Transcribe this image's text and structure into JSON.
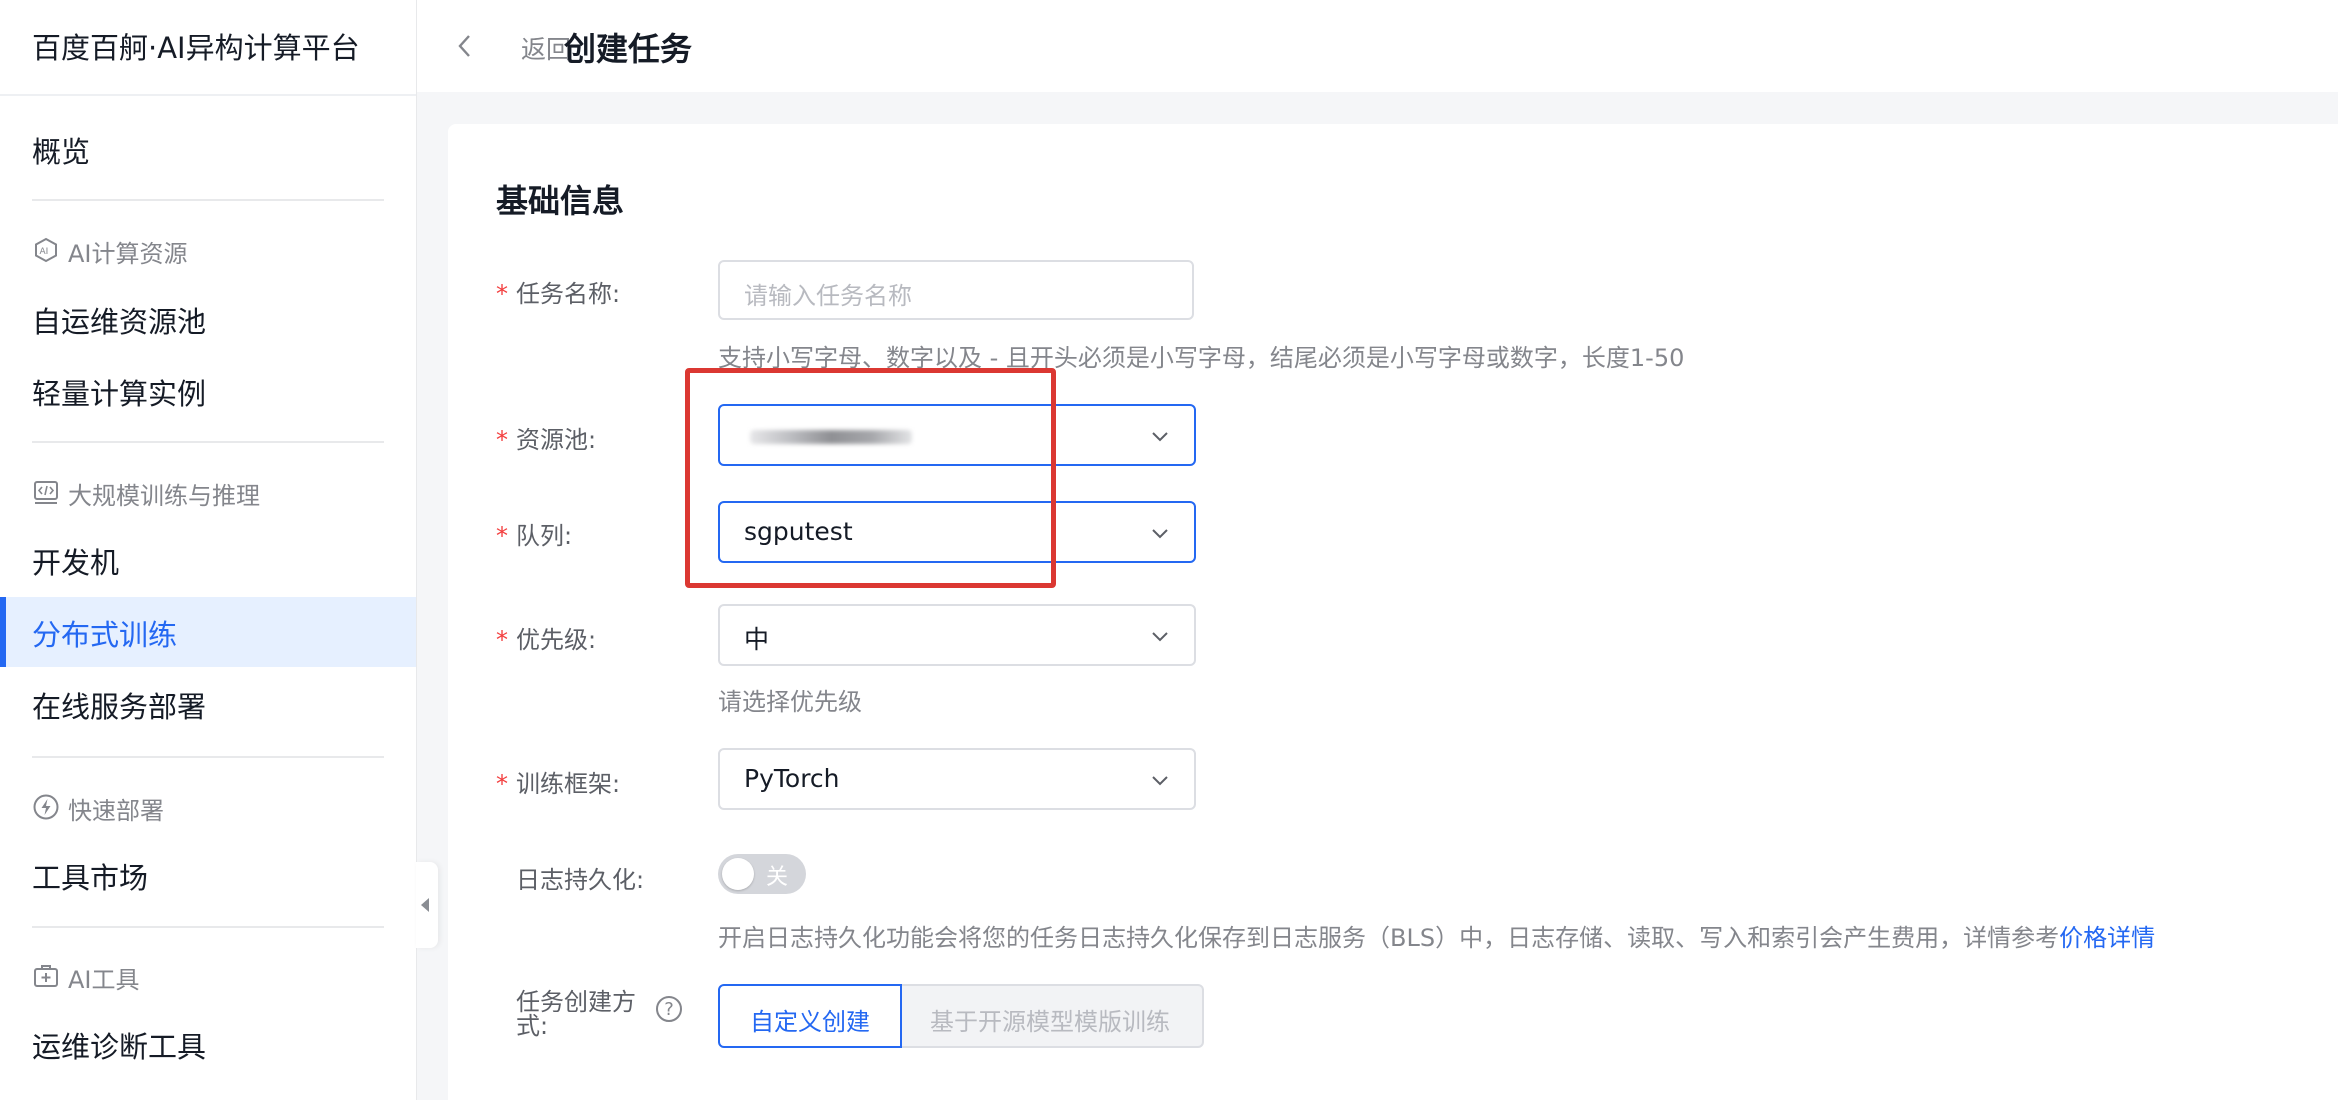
{
  "app": {
    "brand": "百度百舸·AI异构计算平台"
  },
  "sidebar": {
    "overview": "概览",
    "groups": [
      {
        "label": "AI计算资源",
        "icon": "ai-chip-icon"
      },
      {
        "label": "大规模训练与推理",
        "icon": "code-window-icon"
      },
      {
        "label": "快速部署",
        "icon": "lightning-icon"
      },
      {
        "label": "AI工具",
        "icon": "toolbox-icon"
      }
    ],
    "items": {
      "self_ops_pool": "自运维资源池",
      "light_compute": "轻量计算实例",
      "dev_machine": "开发机",
      "distributed_training": "分布式训练",
      "online_service": "在线服务部署",
      "tool_market": "工具市场",
      "ops_diagnosis": "运维诊断工具"
    }
  },
  "header": {
    "back": "返回",
    "title": "创建任务"
  },
  "form": {
    "section_title": "基础信息",
    "task_name": {
      "label": "任务名称:",
      "placeholder": "请输入任务名称",
      "help": "支持小写字母、数字以及 - 且开头必须是小写字母，结尾必须是小写字母或数字，长度1-50"
    },
    "resource_pool": {
      "label": "资源池:",
      "value": ""
    },
    "queue": {
      "label": "队列:",
      "value": "sgputest"
    },
    "priority": {
      "label": "优先级:",
      "value": "中",
      "help": "请选择优先级"
    },
    "framework": {
      "label": "训练框架:",
      "value": "PyTorch"
    },
    "log_persist": {
      "label": "日志持久化:",
      "toggle_text": "关",
      "enabled": false,
      "help": "开启日志持久化功能会将您的任务日志持久化保存到日志服务（BLS）中，日志存储、读取、写入和索引会产生费用，详情参考",
      "help_link": "价格详情"
    },
    "create_mode": {
      "label_line1": "任务创建方",
      "label_line2": "式:",
      "options": [
        "自定义创建",
        "基于开源模型模版训练"
      ],
      "selected": "自定义创建"
    },
    "required_mark": "*"
  },
  "colors": {
    "accent": "#2468f2",
    "required": "#f33e3e",
    "highlight": "#db3832"
  }
}
